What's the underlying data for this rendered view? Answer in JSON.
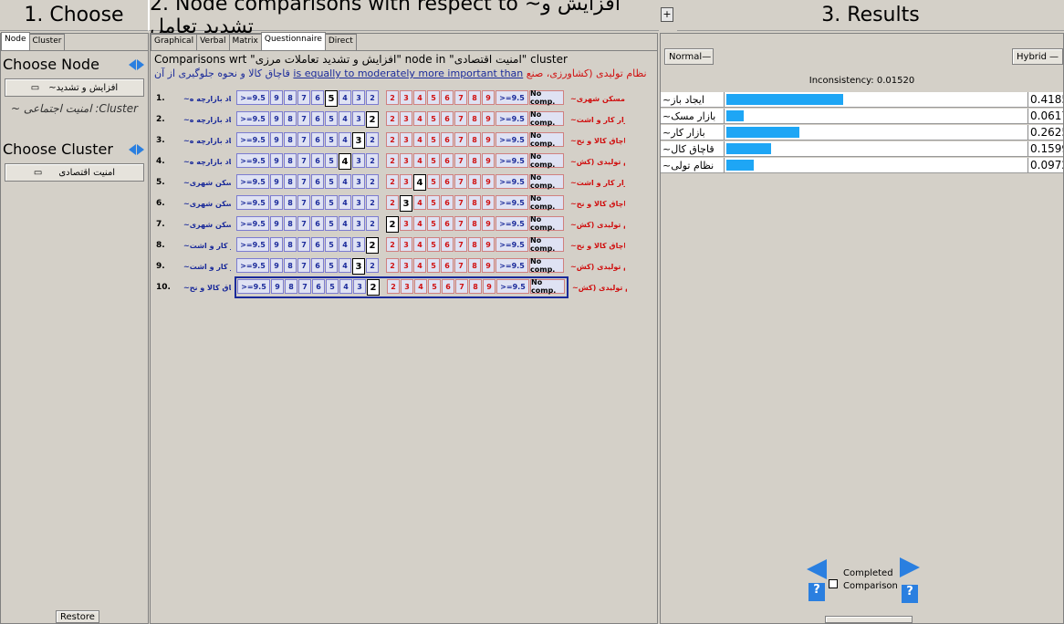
{
  "header": {
    "choose": "1. Choose",
    "comparisons": "2. Node comparisons with respect to ~افزایش و تشدید تعامل",
    "plus": "+",
    "results": "3. Results"
  },
  "left": {
    "tabs": [
      "Node",
      "Cluster"
    ],
    "choose_node": "Choose Node",
    "node_value": "~افزایش و تشدید",
    "cluster_label": "~ امنیت اجتماعی :Cluster",
    "choose_cluster": "Choose Cluster",
    "cluster_value": "امنیت اقتصادی",
    "restore": "Restore"
  },
  "middle": {
    "tabs": [
      "Graphical",
      "Verbal",
      "Matrix",
      "Questionnaire",
      "Direct"
    ],
    "wrt_line": "Comparisons wrt \"افزایش و تشدید تعاملات مرزی\" node in \"امنیت اقتصادی\" cluster",
    "verbal_right": "نظام تولیدی (کشاورزی، صنع",
    "verbal_phrase": "is equally to moderately more important than",
    "verbal_left": "قاچاق کالا و نحوه جلوگیری از آن",
    "scale_left": [
      ">=9.5",
      "9",
      "8",
      "7",
      "6",
      "5",
      "4",
      "3",
      "2"
    ],
    "scale_right": [
      "2",
      "3",
      "4",
      "5",
      "6",
      "7",
      "8",
      "9",
      ">=9.5",
      "No comp."
    ],
    "rows": [
      {
        "n": "1.",
        "left": "~ایجاد بازارچه ه",
        "right": "~بازار مسکن شهری",
        "sel_side": "left",
        "sel": "5"
      },
      {
        "n": "2.",
        "left": "~ایجاد بازارچه ه",
        "right": "~بازار کار و اشت",
        "sel_side": "left",
        "sel": "2"
      },
      {
        "n": "3.",
        "left": "~ایجاد بازارچه ه",
        "right": "~قاچاق کالا و نح",
        "sel_side": "left",
        "sel": "3"
      },
      {
        "n": "4.",
        "left": "~ایجاد بازارچه ه",
        "right": "~نظام تولیدی (کش",
        "sel_side": "left",
        "sel": "4"
      },
      {
        "n": "5.",
        "left": "~بازار مسکن شهری",
        "right": "~بازار کار و اشت",
        "sel_side": "right",
        "sel": "4"
      },
      {
        "n": "6.",
        "left": "~بازار مسکن شهری",
        "right": "~قاچاق کالا و نح",
        "sel_side": "right",
        "sel": "3"
      },
      {
        "n": "7.",
        "left": "~بازار مسکن شهری",
        "right": "~نظام تولیدی (کش",
        "sel_side": "right",
        "sel": "2"
      },
      {
        "n": "8.",
        "left": "~بازار کار و اشت",
        "right": "~قاچاق کالا و نح",
        "sel_side": "left",
        "sel": "2"
      },
      {
        "n": "9.",
        "left": "~بازار کار و اشت",
        "right": "~نظام تولیدی (کش",
        "sel_side": "left",
        "sel": "3"
      },
      {
        "n": "10.",
        "left": "~قاچاق کالا و نح",
        "right": "~نظام تولیدی (کش",
        "sel_side": "left",
        "sel": "2"
      }
    ]
  },
  "results": {
    "normal": "Normal",
    "hybrid": "Hybrid",
    "inconsistency": "Inconsistency: 0.01520",
    "items": [
      {
        "label": "~ایجاد باز",
        "value": "0.4185",
        "frac": 0.4185
      },
      {
        "label": "~بازار مسک",
        "value": "0.0617",
        "frac": 0.0617
      },
      {
        "label": "~بازار کار",
        "value": "0.2625",
        "frac": 0.2625
      },
      {
        "label": "~قاچاق کال",
        "value": "0.1599",
        "frac": 0.1599
      },
      {
        "label": "~نظام تولی",
        "value": "0.0972",
        "frac": 0.0972
      }
    ],
    "completed": "Completed",
    "comparison": "Comparison",
    "question": "?"
  },
  "colors": {
    "accent": "#1ea6f5",
    "left_label": "#1a2a9a",
    "right_label": "#d01010"
  }
}
